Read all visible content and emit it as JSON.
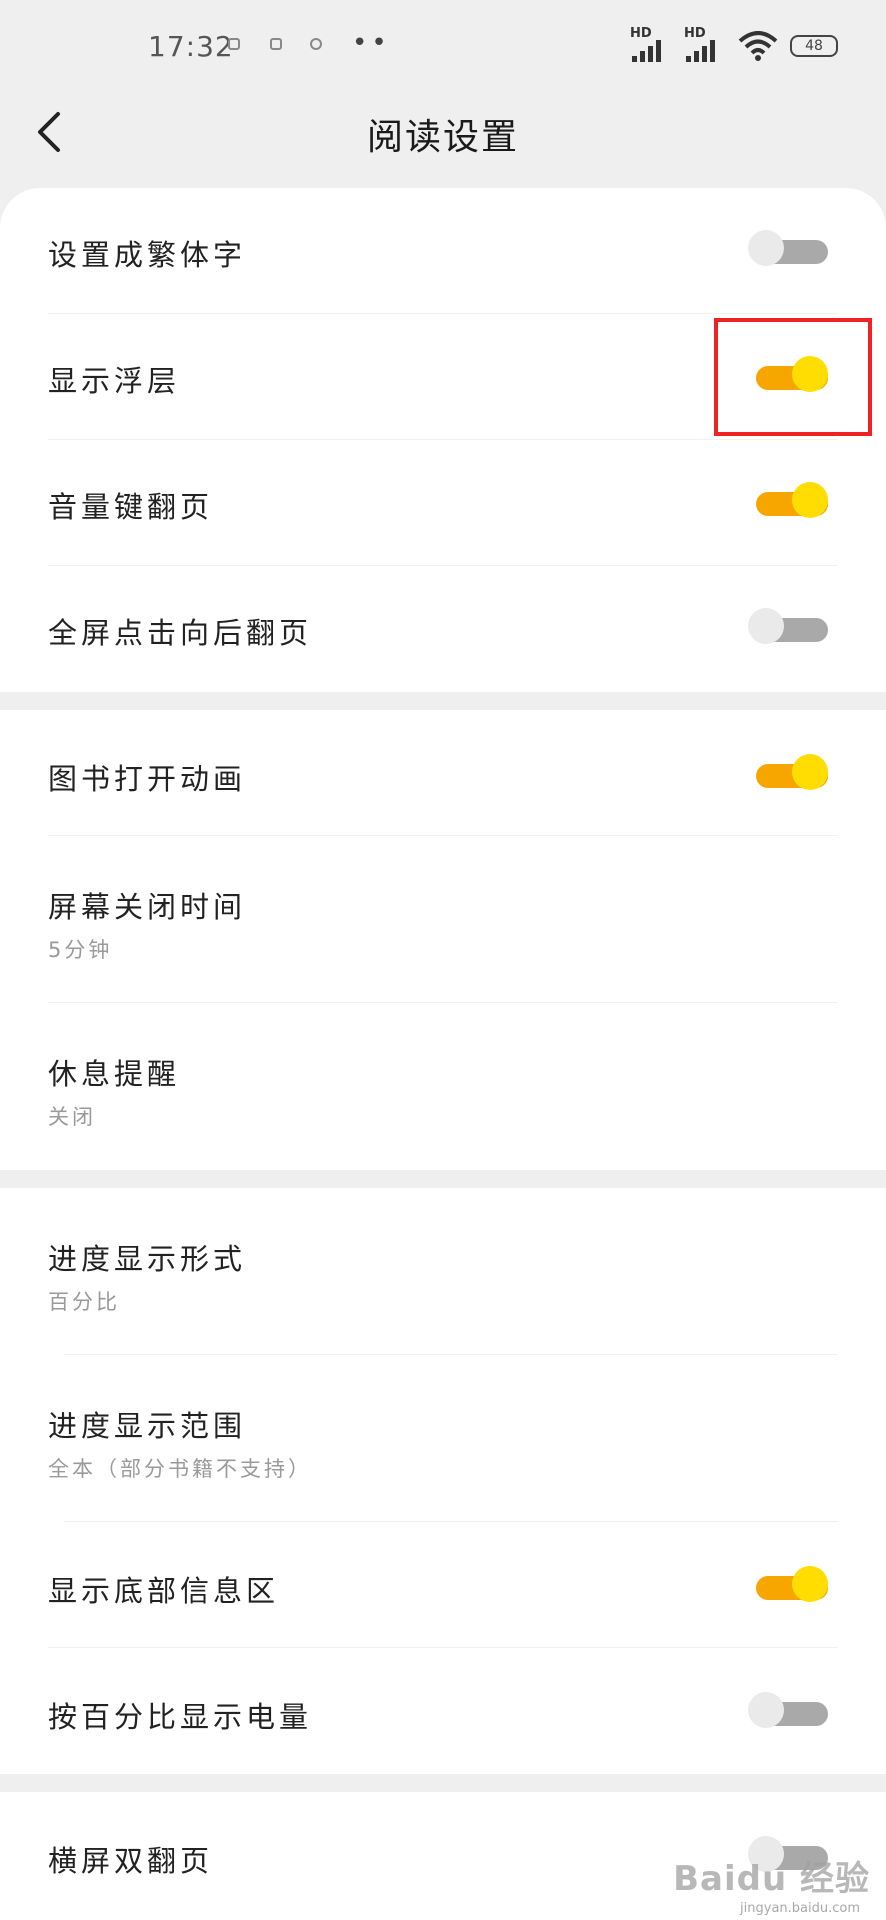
{
  "status_bar": {
    "time": "17:32",
    "dots": "••",
    "battery": "48",
    "signal_label_1": "HD",
    "signal_label_2": "HD"
  },
  "header": {
    "title": "阅读设置"
  },
  "groups": [
    {
      "items": [
        {
          "label": "设置成繁体字",
          "toggle": false
        },
        {
          "label": "显示浮层",
          "toggle": true
        },
        {
          "label": "音量键翻页",
          "toggle": true
        },
        {
          "label": "全屏点击向后翻页",
          "toggle": false
        }
      ]
    },
    {
      "items": [
        {
          "label": "图书打开动画",
          "toggle": true
        },
        {
          "label": "屏幕关闭时间",
          "sub": "5分钟"
        },
        {
          "label": "休息提醒",
          "sub": "关闭"
        }
      ]
    },
    {
      "items": [
        {
          "label": "进度显示形式",
          "sub": "百分比"
        },
        {
          "label": "进度显示范围",
          "sub": "全本（部分书籍不支持）"
        },
        {
          "label": "显示底部信息区",
          "toggle": true
        },
        {
          "label": "按百分比显示电量",
          "toggle": false
        }
      ]
    },
    {
      "items": [
        {
          "label": "横屏双翻页",
          "toggle": false
        }
      ]
    }
  ],
  "watermark": {
    "main": "Baidu 经验",
    "sub": "jingyan.baidu.com"
  },
  "colors": {
    "toggle_on_track": "#f7a600",
    "toggle_on_knob": "#ffdd00",
    "toggle_off_track": "#a9a9a9",
    "highlight": "#ee2222"
  }
}
